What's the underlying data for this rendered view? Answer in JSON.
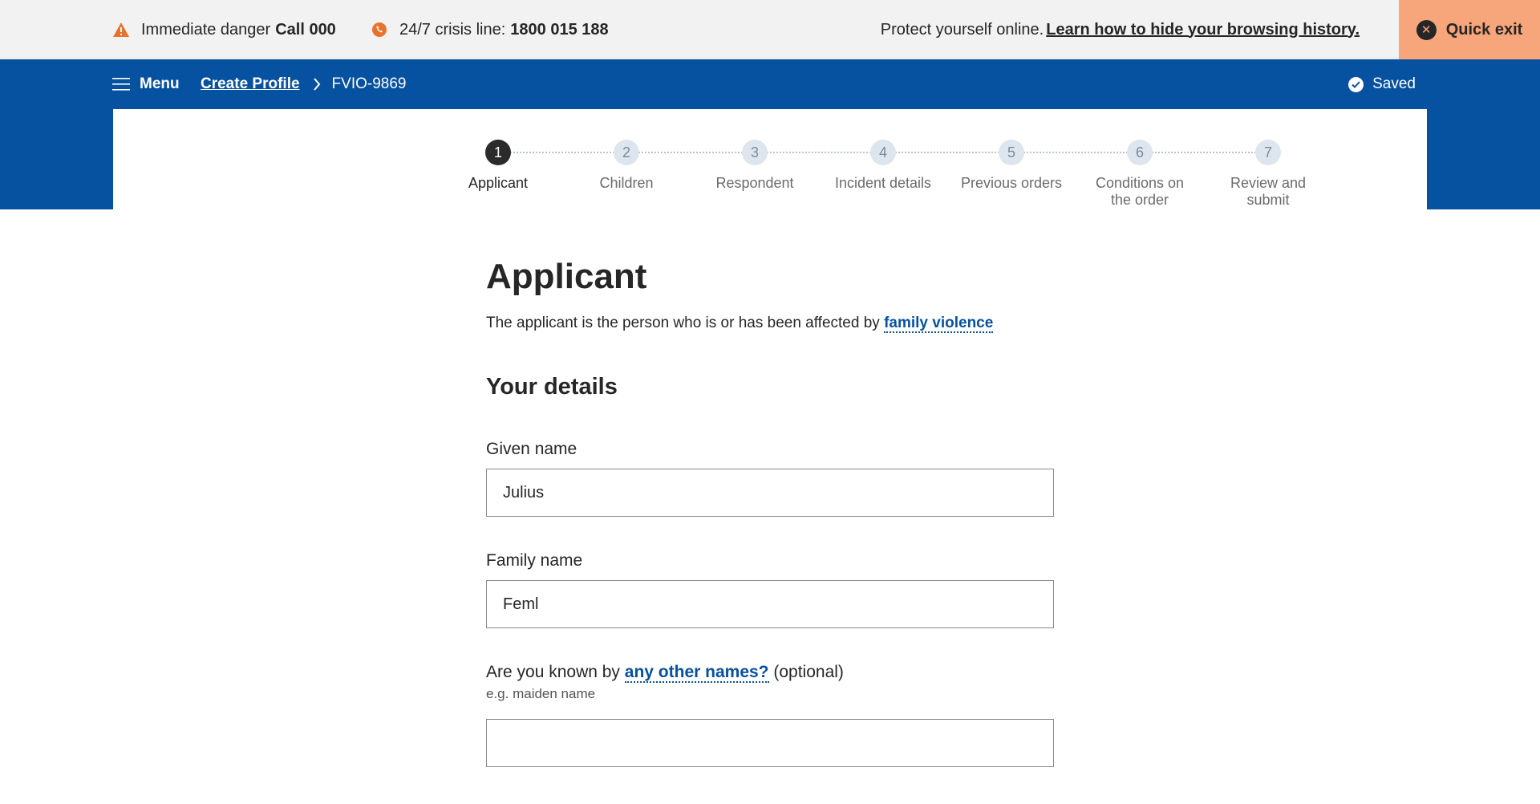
{
  "safety_bar": {
    "danger_text": "Immediate danger",
    "danger_number": "Call 000",
    "crisis_text": "24/7 crisis line:",
    "crisis_number": "1800 015 188",
    "protect_text": "Protect yourself online.",
    "protect_link": "Learn how to hide your browsing history.",
    "quick_exit_label": "Quick exit"
  },
  "header": {
    "menu_label": "Menu",
    "breadcrumb": [
      {
        "label": "Create Profile"
      },
      {
        "label": "FVIO-9869"
      }
    ],
    "saved_label": "Saved"
  },
  "stepper": {
    "steps": [
      {
        "number": "1",
        "label": "Applicant",
        "active": true
      },
      {
        "number": "2",
        "label": "Children",
        "active": false
      },
      {
        "number": "3",
        "label": "Respondent",
        "active": false
      },
      {
        "number": "4",
        "label": "Incident details",
        "active": false
      },
      {
        "number": "5",
        "label": "Previous orders",
        "active": false
      },
      {
        "number": "6",
        "label": "Conditions on the order",
        "active": false
      },
      {
        "number": "7",
        "label": "Review and submit",
        "active": false
      }
    ]
  },
  "main": {
    "title": "Applicant",
    "intro_text": "The applicant is the person who is or has been affected by",
    "intro_link": "family violence",
    "section_title": "Your details",
    "fields": {
      "given_name": {
        "label": "Given name",
        "value": "Julius"
      },
      "family_name": {
        "label": "Family name",
        "value": "Feml"
      },
      "other_names": {
        "label_prefix": "Are you known by",
        "label_link": "any other names?",
        "label_suffix": "(optional)",
        "hint": "e.g. maiden name",
        "value": ""
      }
    }
  },
  "colors": {
    "brand_blue": "#0751a1",
    "quick_exit": "#f7a57a",
    "warning_orange": "#e8732e"
  }
}
